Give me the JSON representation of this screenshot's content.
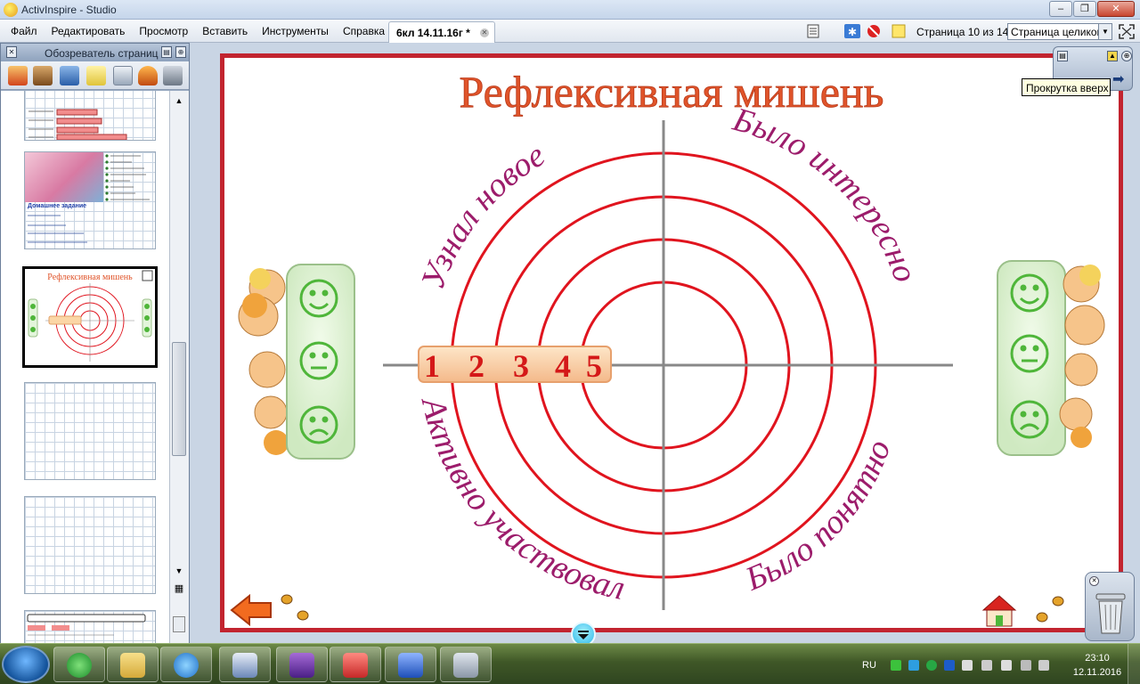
{
  "window": {
    "title": "ActivInspire - Studio"
  },
  "menu": [
    "Файл",
    "Редактировать",
    "Просмотр",
    "Вставить",
    "Инструменты",
    "Справка"
  ],
  "document_tab": "6кл 14.11.16г *",
  "page_indicator": "Страница 10 из 14",
  "zoom": "Страница целиком",
  "page_browser": {
    "title": "Обозреватель страниц",
    "thumb_homework_title": "Домашнее задание"
  },
  "slide": {
    "title": "Рефлексивная мишень",
    "arc_top_left": "Узнал новое",
    "arc_top_right": "Было интересно",
    "arc_bottom_left": "Активно участвовал",
    "arc_bottom_right": "Было понятно",
    "scale": [
      "1",
      "2",
      "3",
      "4",
      "5"
    ],
    "faces": [
      "happy",
      "neutral",
      "sad"
    ]
  },
  "tooltip": "Прокрутка вверх",
  "taskbar": {
    "lang": "RU",
    "time": "23:10",
    "date": "12.11.2016"
  },
  "colors": {
    "accent_red": "#c2242f",
    "title_orange": "#e0542a",
    "arc_text": "#9c1c6b",
    "target_red": "#e0141e",
    "face_green": "#4fb63a",
    "panel_green": "#e3f5db"
  }
}
